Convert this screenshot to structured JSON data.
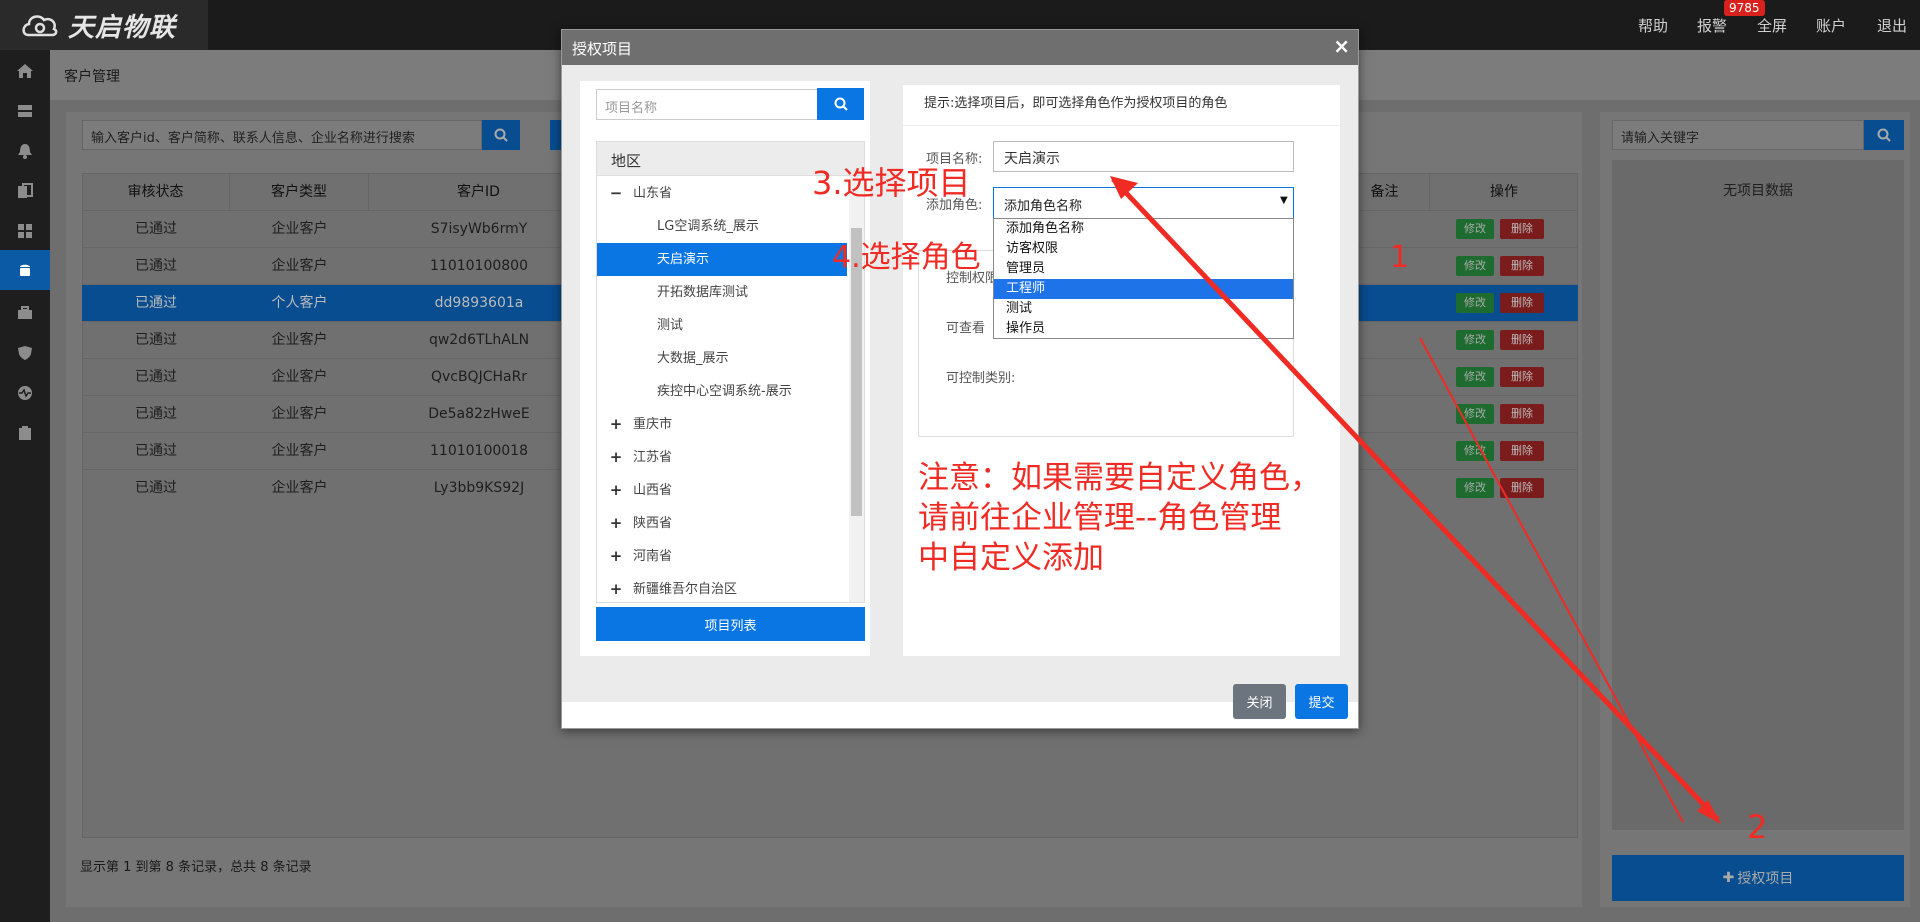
{
  "app": {
    "logo_text": "天启物联"
  },
  "topbar": {
    "links": [
      "帮助",
      "报警",
      "全屏",
      "账户",
      "退出"
    ],
    "alarm_badge": "9785"
  },
  "breadcrumb": "客户管理",
  "search": {
    "placeholder": "输入客户id、客户简称、联系人信息、企业名称进行搜索"
  },
  "table": {
    "headers": [
      "审核状态",
      "客户类型",
      "客户ID",
      "备注",
      "操作"
    ],
    "rows": [
      [
        "已通过",
        "企业客户",
        "S7isyWb6rmY"
      ],
      [
        "已通过",
        "企业客户",
        "11010100800"
      ],
      [
        "已通过",
        "个人客户",
        "dd9893601a"
      ],
      [
        "已通过",
        "企业客户",
        "qw2d6TLhALN"
      ],
      [
        "已通过",
        "企业客户",
        "QvcBQJCHaRr"
      ],
      [
        "已通过",
        "企业客户",
        "De5a82zHweE"
      ],
      [
        "已通过",
        "企业客户",
        "11010100018"
      ],
      [
        "已通过",
        "企业客户",
        "Ly3bb9KS92J"
      ]
    ],
    "edit_label": "修改",
    "delete_label": "删除",
    "footer": "显示第 1 到第 8 条记录，总共 8 条记录"
  },
  "right_panel": {
    "search_placeholder": "请输入关键字",
    "empty_text": "无项目数据",
    "auth_button": "授权项目"
  },
  "modal": {
    "title": "授权项目",
    "project_search_placeholder": "项目名称",
    "tree_header": "地区",
    "tree": [
      {
        "label": "山东省",
        "sign": "−"
      },
      {
        "label": "LG空调系统_展示"
      },
      {
        "label": "天启演示"
      },
      {
        "label": "开拓数据库测试"
      },
      {
        "label": "测试"
      },
      {
        "label": "大数据_展示"
      },
      {
        "label": "疾控中心空调系统-展示"
      },
      {
        "label": "重庆市",
        "sign": "+"
      },
      {
        "label": "江苏省",
        "sign": "+"
      },
      {
        "label": "山西省",
        "sign": "+"
      },
      {
        "label": "陕西省",
        "sign": "+"
      },
      {
        "label": "河南省",
        "sign": "+"
      },
      {
        "label": "新疆维吾尔自治区",
        "sign": "+"
      }
    ],
    "project_list_button": "项目列表",
    "hint": "提示:选择项目后，即可选择角色作为授权项目的角色",
    "project_name_label": "项目名称:",
    "project_name_value": "天启演示",
    "add_role_label": "添加角色:",
    "role_select_value": "添加角色名称",
    "role_options": [
      "添加角色名称",
      "访客权限",
      "管理员",
      "工程师",
      "测试",
      "操作员"
    ],
    "control_perm_label": "控制权限",
    "view_label": "可查看",
    "control_category_label": "可控制类别:",
    "close_button": "关闭",
    "submit_button": "提交"
  },
  "annotations": {
    "step3": "3.选择项目",
    "step4": "4.选择角色",
    "num1": "1",
    "num2": "2",
    "note_line1": "注意：如果需要自定义角色，",
    "note_line2": "请前往企业管理--角色管理",
    "note_line3": "中自定义添加",
    "color": "#ef2b24"
  }
}
